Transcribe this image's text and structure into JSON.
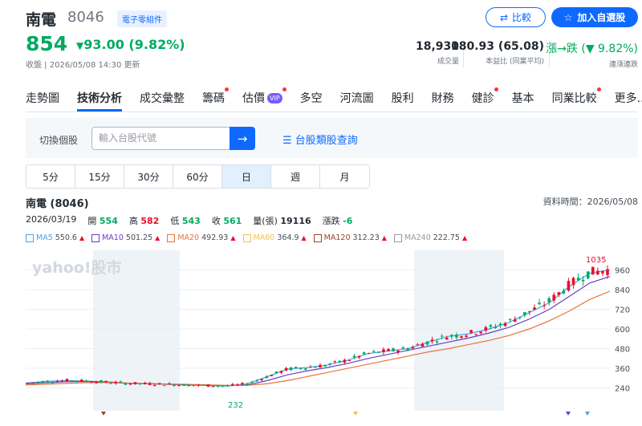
{
  "stock": {
    "name": "南電",
    "code": "8046",
    "industry": "電子零組件",
    "price": "854",
    "change": "93.00 (9.82%)",
    "close_time": "收盤 | 2026/05/08 14:30 更新"
  },
  "buttons": {
    "compare": "比較",
    "add_watchlist": "加入自選股"
  },
  "stats": [
    {
      "value": "18,930",
      "label": "成交量"
    },
    {
      "value": "180.93 (65.08)",
      "label": "本益比 (同業平均)"
    },
    {
      "value": "漲→跌 (▼ 9.82%)",
      "label": "連漲連跌"
    }
  ],
  "tabs": [
    {
      "label": "走勢圖"
    },
    {
      "label": "技術分析"
    },
    {
      "label": "成交彙整"
    },
    {
      "label": "籌碼"
    },
    {
      "label": "估價"
    },
    {
      "label": "多空"
    },
    {
      "label": "河流圖"
    },
    {
      "label": "股利"
    },
    {
      "label": "財務"
    },
    {
      "label": "健診"
    },
    {
      "label": "基本"
    },
    {
      "label": "同業比較"
    },
    {
      "label": "更多..."
    }
  ],
  "vip_label": "VIP",
  "switch": {
    "label": "切換個股",
    "placeholder": "輸入台股代號",
    "category_link": "台股類股查詢"
  },
  "periods": [
    "5分",
    "15分",
    "30分",
    "60分",
    "日",
    "週",
    "月"
  ],
  "chart_header": {
    "title": "南電 (8046)",
    "data_time": "資料時間：2026/05/08",
    "date": "2026/03/19",
    "open_label": "開",
    "open": "554",
    "high_label": "高",
    "high": "582",
    "low_label": "低",
    "low": "543",
    "close_label": "收",
    "close": "561",
    "volume_label": "量(張)",
    "volume": "19116",
    "change_label": "漲跌",
    "change": "-6"
  },
  "ma_legend": [
    {
      "name": "MA5",
      "value": "550.6",
      "color": "#4aa3e8"
    },
    {
      "name": "MA10",
      "value": "501.25",
      "color": "#6a3fc0"
    },
    {
      "name": "MA20",
      "value": "492.93",
      "color": "#e8733a"
    },
    {
      "name": "MA60",
      "value": "364.9",
      "color": "#f0c050"
    },
    {
      "name": "MA120",
      "value": "312.23",
      "color": "#a0402a"
    },
    {
      "name": "MA240",
      "value": "222.75",
      "color": "#999999"
    }
  ],
  "chart_data": {
    "type": "line",
    "watermark": "yahoo!股市",
    "y_ticks": [
      "960",
      "840",
      "720",
      "600",
      "480",
      "360",
      "240"
    ],
    "ylim": [
      140,
      1060
    ],
    "annotations": [
      {
        "text": "1035",
        "color": "#eb0f29"
      },
      {
        "text": "232",
        "color": "#00ab5e"
      }
    ],
    "series": [
      {
        "name": "MA5",
        "values": [
          270,
          280,
          285,
          282,
          275,
          268,
          265,
          262,
          258,
          255,
          252,
          265,
          310,
          355,
          365,
          380,
          410,
          450,
          465,
          480,
          520,
          555,
          570,
          600,
          640,
          700,
          760,
          860,
          940,
          960
        ]
      },
      {
        "name": "MA10",
        "values": [
          265,
          272,
          278,
          280,
          277,
          270,
          266,
          263,
          260,
          257,
          254,
          258,
          285,
          320,
          345,
          365,
          390,
          420,
          445,
          470,
          495,
          520,
          545,
          575,
          610,
          660,
          720,
          800,
          880,
          920
        ]
      },
      {
        "name": "MA20",
        "values": [
          258,
          263,
          268,
          272,
          273,
          270,
          267,
          264,
          262,
          259,
          256,
          256,
          266,
          285,
          310,
          335,
          360,
          385,
          410,
          435,
          460,
          480,
          505,
          530,
          560,
          600,
          650,
          710,
          780,
          830
        ]
      }
    ]
  }
}
